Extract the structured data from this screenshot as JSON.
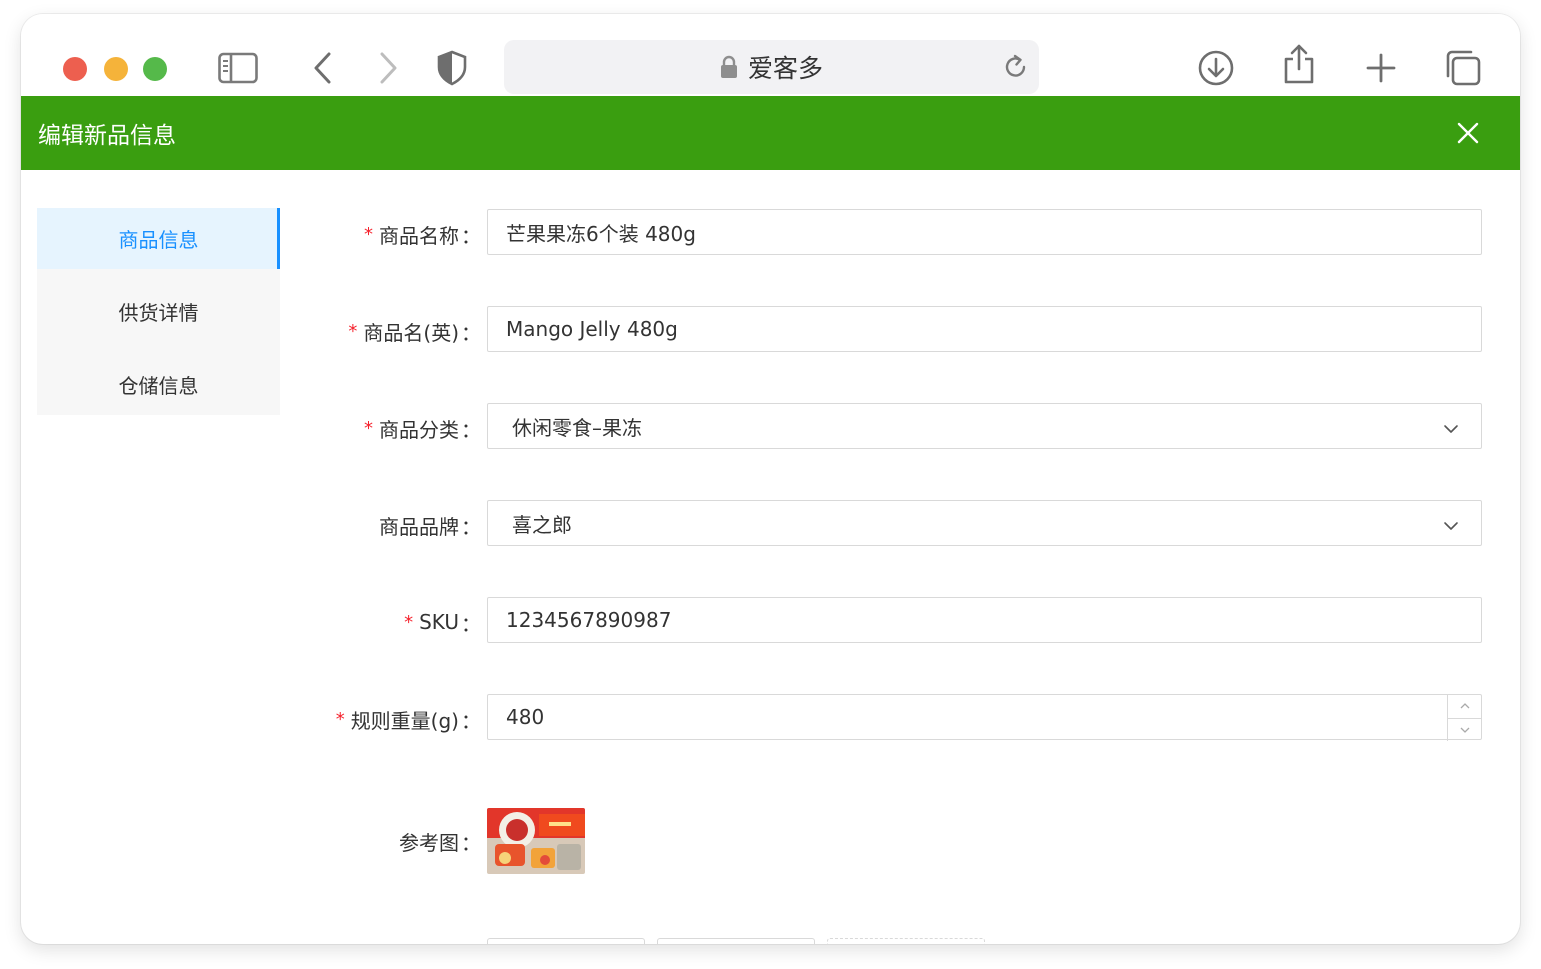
{
  "browser": {
    "url_title": "爱客多",
    "toolbar_icons": [
      "sidebar-icon",
      "back-icon",
      "forward-icon",
      "shield-icon",
      "download-icon",
      "share-icon",
      "plus-icon",
      "tabs-icon"
    ]
  },
  "dialog": {
    "title": "编辑新品信息",
    "accent_color": "#3a9e10"
  },
  "sidebar": {
    "items": [
      {
        "label": "商品信息",
        "active": true
      },
      {
        "label": "供货详情",
        "active": false
      },
      {
        "label": "仓储信息",
        "active": false
      }
    ]
  },
  "form": {
    "name": {
      "label": "商品名称",
      "value": "芒果果冻6个装 480g",
      "required": true
    },
    "name_en": {
      "label": "商品名(英)",
      "value": "Mango Jelly 480g",
      "required": true
    },
    "category": {
      "label": "商品分类",
      "value": "休闲零食–果冻",
      "required": true
    },
    "brand": {
      "label": "商品品牌",
      "value": "喜之郎",
      "required": false
    },
    "sku": {
      "label": "SKU",
      "value": "1234567890987",
      "required": true
    },
    "weight": {
      "label": "规则重量(g)",
      "value": "480",
      "required": true
    },
    "reference_image": {
      "label": "参考图"
    }
  },
  "colon": "：",
  "required_mark": "*"
}
